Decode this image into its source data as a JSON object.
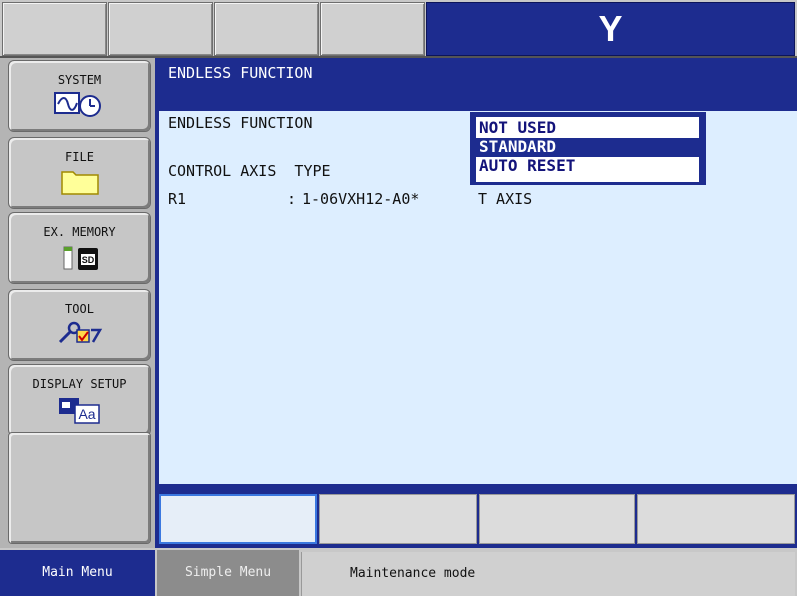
{
  "top": {
    "logo": "Y"
  },
  "left_menu": {
    "items": [
      {
        "label": "SYSTEM",
        "icon": "system-wave-clock-icon"
      },
      {
        "label": "FILE",
        "icon": "folder-icon"
      },
      {
        "label": "EX. MEMORY",
        "icon": "sd-card-icon",
        "badge": "SD"
      },
      {
        "label": "TOOL",
        "icon": "tool-check-icon"
      },
      {
        "label": "DISPLAY SETUP",
        "icon": "display-font-icon",
        "badge": "Aa"
      }
    ]
  },
  "main": {
    "title": "ENDLESS FUNCTION",
    "field_label": "ENDLESS FUNCTION",
    "header_row": "CONTROL AXIS  TYPE",
    "row": {
      "axis": "R1",
      "sep": ":",
      "type": "1-06VXH12-A0*",
      "axis_name": "T AXIS"
    }
  },
  "dropdown": {
    "options": [
      "NOT USED",
      "STANDARD",
      "AUTO RESET"
    ],
    "selected": "STANDARD"
  },
  "bottom": {
    "main_menu": "Main Menu",
    "simple_menu": "Simple Menu",
    "status": "Maintenance mode"
  },
  "colors": {
    "frame_blue": "#1d2c8f",
    "content_bg": "#ddeeff",
    "gray": "#c8c8c8"
  }
}
